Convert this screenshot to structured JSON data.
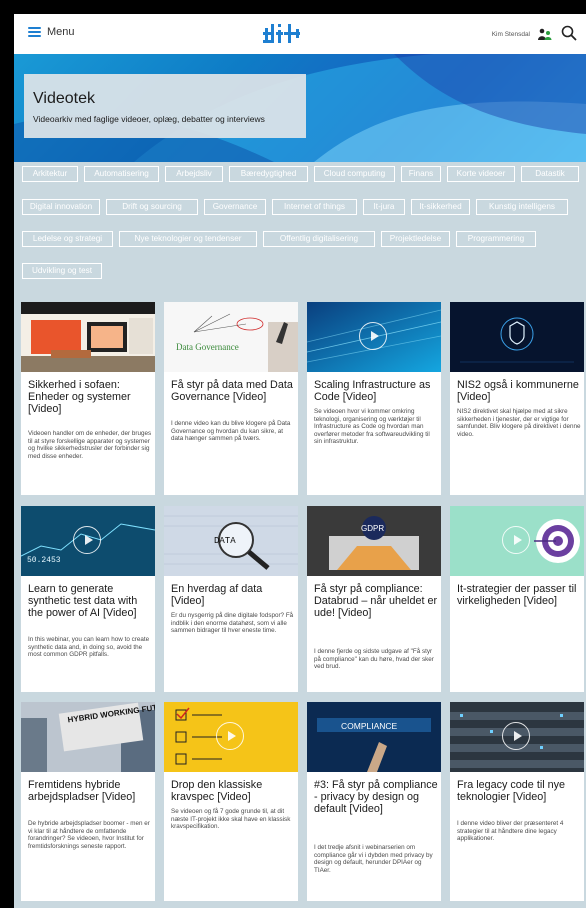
{
  "header": {
    "menu_label": "Menu",
    "user_name": "Kim Stensdal",
    "brand_color": "#1e7fd1"
  },
  "hero": {
    "title": "Videotek",
    "subtitle": "Videoarkiv med faglige videoer, oplæg, debatter og interviews"
  },
  "tags": [
    "Arkitektur",
    "Automatisering",
    "Arbejdsliv",
    "Bæredygtighed",
    "Cloud computing",
    "Finans",
    "Korte videoer",
    "Datastik",
    "Digital innovation",
    "Drift og sourcing",
    "Governance",
    "Internet of things",
    "It-jura",
    "It-sikkerhed",
    "Kunstig intelligens",
    "Ledelse og strategi",
    "Nye teknologier og tendenser",
    "Offentlig digitalisering",
    "Projektledelse",
    "Programmering",
    "Udvikling og test"
  ],
  "cards": [
    {
      "title": "Sikkerhed i sofaen: Enheder og systemer [Video]",
      "desc": "Videoen handler om de enheder, der bruges til at styre forskellige apparater og systemer og hvilke sikkerhedstrusler der forbinder sig med disse enheder.",
      "thumb_text": ""
    },
    {
      "title": "Få styr på data med Data Governance [Video]",
      "desc": "I denne video kan du blive klogere på Data Governance og hvordan du kan sikre, at data hænger sammen på tværs.",
      "thumb_text": "Data Governance"
    },
    {
      "title": "Scaling Infrastructure as Code [Video]",
      "desc": "Se videoen hvor vi kommer omkring teknologi, organisering og værktøjer til Infrastructure as Code og hvordan man overfører metoder fra softwareudvikling til sin infrastruktur.",
      "thumb_text": ""
    },
    {
      "title": "NIS2 også i kommunerne [Video]",
      "desc": "NIS2 direktivet skal hjælpe med at sikre sikkerheden i tjenester, der er vigtige for samfundet. Bliv klogere på direktivet i denne video.",
      "thumb_text": ""
    },
    {
      "title": "Learn to generate synthetic test data with the power of AI [Video]",
      "desc": "In this webinar, you can learn how to create synthetic data and, in doing so, avoid the most common GDPR pitfalls.",
      "thumb_text": "50.2453"
    },
    {
      "title": "En hverdag af data [Video]",
      "desc": "Er du nysgerrig på dine digitale fodspor? Få indblik i den enorme datahøst, som vi alle sammen bidrager til hver eneste time.",
      "thumb_text": "DATA"
    },
    {
      "title": "Få styr på compliance: Databrud – når uheldet er ude! [Video]",
      "desc": "I denne fjerde og sidste udgave af \"Få styr på compliance\" kan du høre, hvad der sker ved brud.",
      "thumb_text": "GDPR"
    },
    {
      "title": "It-strategier der passer til virkeligheden [Video]",
      "desc": "",
      "thumb_text": ""
    },
    {
      "title": "Fremtidens hybride arbejdspladser [Video]",
      "desc": "De hybride arbejdspladser boomer - men er vi klar til at håndtere de omfattende forandringer? Se videoen, hvor Institut for fremtidsforsknings seneste rapport.",
      "thumb_text": "HYBRID WORKING FUTURE"
    },
    {
      "title": "Drop den klassiske kravspec [Video]",
      "desc": "Se videoen og få 7 gode grunde til, at dit næste IT-projekt ikke skal have en klassisk kravspecifikation.",
      "thumb_text": ""
    },
    {
      "title": "#3: Få styr på compliance - privacy by design og default [Video]",
      "desc": "I det tredje afsnit i webinarserien om compliance går vi i dybden med privacy by design og default, herunder DPIAer og TIAer.",
      "thumb_text": "COMPLIANCE"
    },
    {
      "title": "Fra legacy code til nye teknologier [Video]",
      "desc": "I denne video bliver der præsenteret 4 strategier til at håndtere dine legacy applikationer.",
      "thumb_text": ""
    }
  ]
}
